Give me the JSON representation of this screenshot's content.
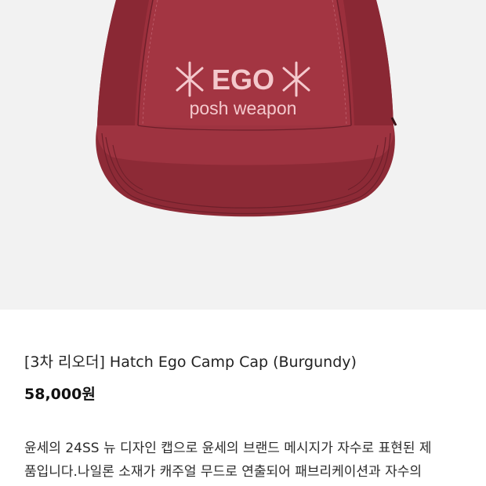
{
  "product": {
    "image": {
      "embroidery_line1": "EGO",
      "embroidery_line2": "posh weapon",
      "cap_color": "#9b2f3c",
      "thread_color": "#f4c9cd",
      "background": "#f2f2f2"
    },
    "title": "[3차 리오더] Hatch Ego Camp Cap (Burgundy)",
    "price": "58,000원",
    "description_lines": [
      "윤세의 24SS 뉴 디자인 캡으로 윤세의 브랜드 메시지가 자수로 표현된 제",
      "품입니다.나일론 소재가 캐주얼 무드로 연출되어 패브리케이션과 자수의"
    ]
  }
}
